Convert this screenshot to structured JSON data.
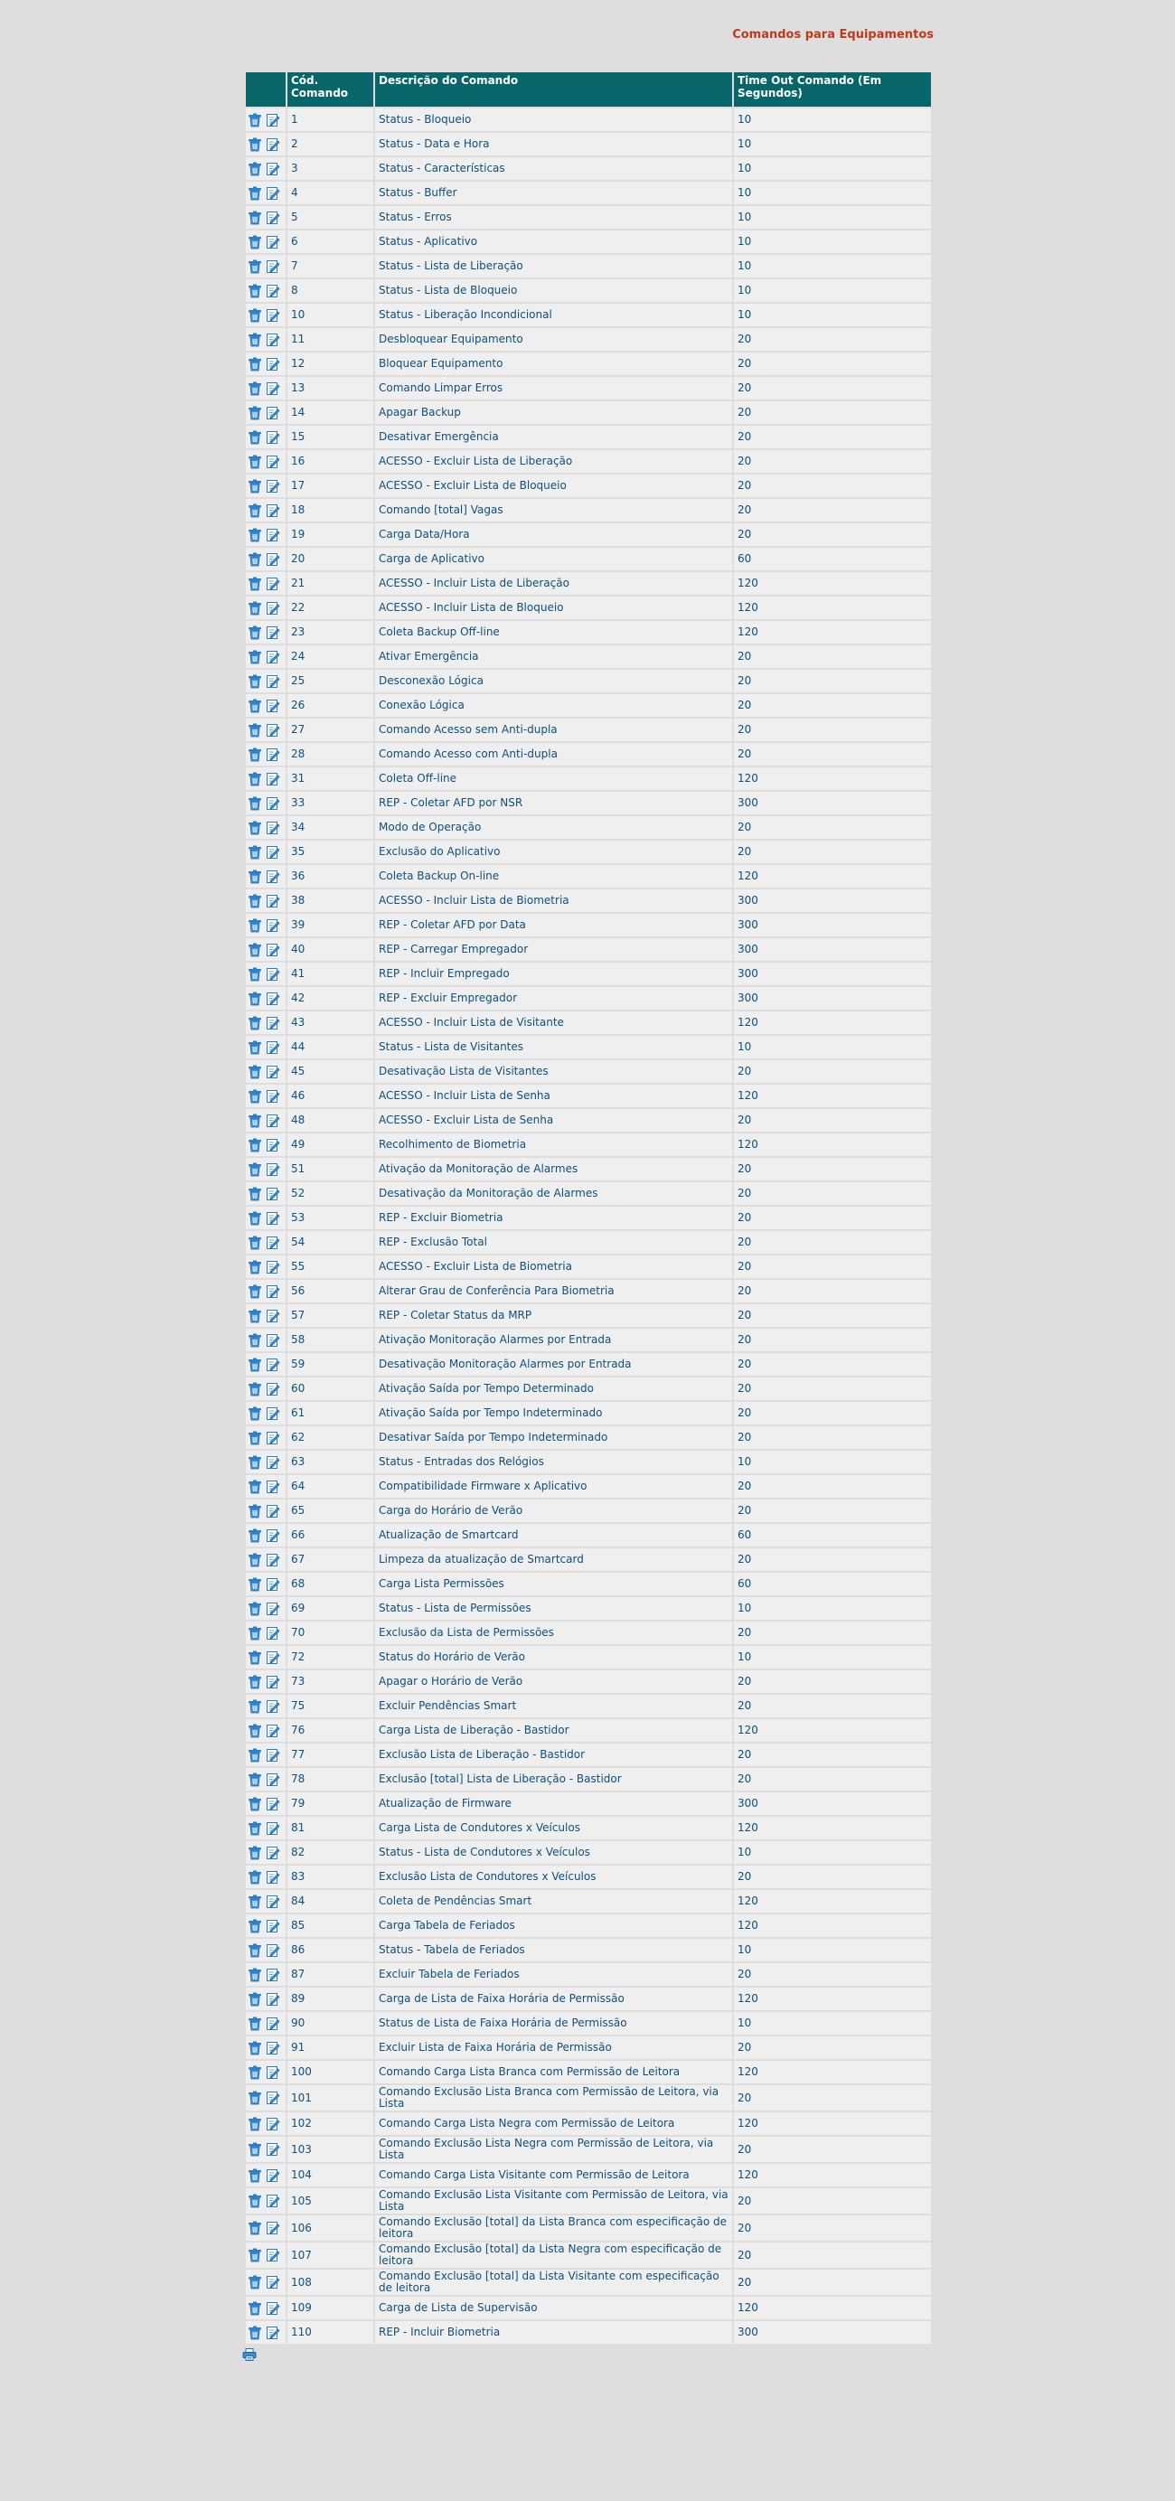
{
  "page": {
    "title": "Comandos para Equipamentos"
  },
  "table": {
    "headers": {
      "actions": "",
      "code": "Cód. Comando",
      "description": "Descrição do Comando",
      "timeout": "Time Out Comando (Em Segundos)"
    },
    "icons": {
      "delete": "trash-icon",
      "edit": "edit-icon",
      "print": "print-icon"
    },
    "rows": [
      {
        "code": "1",
        "description": "Status - Bloqueio",
        "timeout": "10"
      },
      {
        "code": "2",
        "description": "Status - Data e Hora",
        "timeout": "10"
      },
      {
        "code": "3",
        "description": "Status - Características",
        "timeout": "10"
      },
      {
        "code": "4",
        "description": "Status - Buffer",
        "timeout": "10"
      },
      {
        "code": "5",
        "description": "Status - Erros",
        "timeout": "10"
      },
      {
        "code": "6",
        "description": "Status - Aplicativo",
        "timeout": "10"
      },
      {
        "code": "7",
        "description": "Status - Lista de Liberação",
        "timeout": "10"
      },
      {
        "code": "8",
        "description": "Status - Lista de Bloqueio",
        "timeout": "10"
      },
      {
        "code": "10",
        "description": "Status - Liberação Incondicional",
        "timeout": "10"
      },
      {
        "code": "11",
        "description": "Desbloquear Equipamento",
        "timeout": "20"
      },
      {
        "code": "12",
        "description": "Bloquear Equipamento",
        "timeout": "20"
      },
      {
        "code": "13",
        "description": "Comando Limpar Erros",
        "timeout": "20"
      },
      {
        "code": "14",
        "description": "Apagar Backup",
        "timeout": "20"
      },
      {
        "code": "15",
        "description": "Desativar Emergência",
        "timeout": "20"
      },
      {
        "code": "16",
        "description": "ACESSO - Excluir Lista de Liberação",
        "timeout": "20"
      },
      {
        "code": "17",
        "description": "ACESSO - Excluir Lista de Bloqueio",
        "timeout": "20"
      },
      {
        "code": "18",
        "description": "Comando [total] Vagas",
        "timeout": "20"
      },
      {
        "code": "19",
        "description": "Carga Data/Hora",
        "timeout": "20"
      },
      {
        "code": "20",
        "description": "Carga de Aplicativo",
        "timeout": "60"
      },
      {
        "code": "21",
        "description": "ACESSO - Incluir Lista de Liberação",
        "timeout": "120"
      },
      {
        "code": "22",
        "description": "ACESSO - Incluir Lista de Bloqueio",
        "timeout": "120"
      },
      {
        "code": "23",
        "description": "Coleta Backup Off-line",
        "timeout": "120"
      },
      {
        "code": "24",
        "description": "Ativar Emergência",
        "timeout": "20"
      },
      {
        "code": "25",
        "description": "Desconexão Lógica",
        "timeout": "20"
      },
      {
        "code": "26",
        "description": "Conexão Lógica",
        "timeout": "20"
      },
      {
        "code": "27",
        "description": "Comando Acesso sem Anti-dupla",
        "timeout": "20"
      },
      {
        "code": "28",
        "description": "Comando Acesso com Anti-dupla",
        "timeout": "20"
      },
      {
        "code": "31",
        "description": "Coleta Off-line",
        "timeout": "120"
      },
      {
        "code": "33",
        "description": "REP - Coletar AFD por NSR",
        "timeout": "300"
      },
      {
        "code": "34",
        "description": "Modo de Operação",
        "timeout": "20"
      },
      {
        "code": "35",
        "description": "Exclusão do Aplicativo",
        "timeout": "20"
      },
      {
        "code": "36",
        "description": "Coleta Backup On-line",
        "timeout": "120"
      },
      {
        "code": "38",
        "description": "ACESSO - Incluir Lista de Biometria",
        "timeout": "300"
      },
      {
        "code": "39",
        "description": "REP - Coletar AFD por Data",
        "timeout": "300"
      },
      {
        "code": "40",
        "description": "REP - Carregar Empregador",
        "timeout": "300"
      },
      {
        "code": "41",
        "description": "REP - Incluir Empregado",
        "timeout": "300"
      },
      {
        "code": "42",
        "description": "REP - Excluir Empregador",
        "timeout": "300"
      },
      {
        "code": "43",
        "description": "ACESSO - Incluir Lista de Visitante",
        "timeout": "120"
      },
      {
        "code": "44",
        "description": "Status - Lista de Visitantes",
        "timeout": "10"
      },
      {
        "code": "45",
        "description": "Desativação Lista de Visitantes",
        "timeout": "20"
      },
      {
        "code": "46",
        "description": "ACESSO - Incluir Lista de Senha",
        "timeout": "120"
      },
      {
        "code": "48",
        "description": "ACESSO - Excluir Lista de Senha",
        "timeout": "20"
      },
      {
        "code": "49",
        "description": "Recolhimento de Biometria",
        "timeout": "120"
      },
      {
        "code": "51",
        "description": "Ativação da Monitoração de Alarmes",
        "timeout": "20"
      },
      {
        "code": "52",
        "description": "Desativação da Monitoração de Alarmes",
        "timeout": "20"
      },
      {
        "code": "53",
        "description": "REP - Excluir Biometria",
        "timeout": "20"
      },
      {
        "code": "54",
        "description": "REP - Exclusão Total",
        "timeout": "20"
      },
      {
        "code": "55",
        "description": "ACESSO - Excluir Lista de Biometria",
        "timeout": "20"
      },
      {
        "code": "56",
        "description": "Alterar Grau de Conferência Para Biometria",
        "timeout": "20"
      },
      {
        "code": "57",
        "description": "REP - Coletar Status da MRP",
        "timeout": "20"
      },
      {
        "code": "58",
        "description": "Ativação Monitoração Alarmes por Entrada",
        "timeout": "20"
      },
      {
        "code": "59",
        "description": "Desativação Monitoração Alarmes por Entrada",
        "timeout": "20"
      },
      {
        "code": "60",
        "description": "Ativação Saída por Tempo Determinado",
        "timeout": "20"
      },
      {
        "code": "61",
        "description": "Ativação Saída por Tempo Indeterminado",
        "timeout": "20"
      },
      {
        "code": "62",
        "description": "Desativar Saída por Tempo Indeterminado",
        "timeout": "20"
      },
      {
        "code": "63",
        "description": "Status - Entradas dos Relógios",
        "timeout": "10"
      },
      {
        "code": "64",
        "description": "Compatibilidade Firmware x Aplicativo",
        "timeout": "20"
      },
      {
        "code": "65",
        "description": "Carga do Horário de Verão",
        "timeout": "20"
      },
      {
        "code": "66",
        "description": "Atualização de Smartcard",
        "timeout": "60"
      },
      {
        "code": "67",
        "description": "Limpeza da atualização de Smartcard",
        "timeout": "20"
      },
      {
        "code": "68",
        "description": "Carga Lista Permissões",
        "timeout": "60"
      },
      {
        "code": "69",
        "description": "Status - Lista de Permissões",
        "timeout": "10"
      },
      {
        "code": "70",
        "description": "Exclusão da Lista de Permissões",
        "timeout": "20"
      },
      {
        "code": "72",
        "description": "Status do Horário de Verão",
        "timeout": "10"
      },
      {
        "code": "73",
        "description": "Apagar o Horário de Verão",
        "timeout": "20"
      },
      {
        "code": "75",
        "description": "Excluir Pendências Smart",
        "timeout": "20"
      },
      {
        "code": "76",
        "description": "Carga Lista de Liberação - Bastidor",
        "timeout": "120"
      },
      {
        "code": "77",
        "description": "Exclusão Lista de Liberação - Bastidor",
        "timeout": "20"
      },
      {
        "code": "78",
        "description": "Exclusão [total] Lista de Liberação - Bastidor",
        "timeout": "20"
      },
      {
        "code": "79",
        "description": "Atualização de Firmware",
        "timeout": "300"
      },
      {
        "code": "81",
        "description": "Carga Lista de Condutores x Veículos",
        "timeout": "120"
      },
      {
        "code": "82",
        "description": "Status - Lista de Condutores x Veículos",
        "timeout": "10"
      },
      {
        "code": "83",
        "description": "Exclusão Lista de Condutores x Veículos",
        "timeout": "20"
      },
      {
        "code": "84",
        "description": "Coleta de Pendências Smart",
        "timeout": "120"
      },
      {
        "code": "85",
        "description": "Carga Tabela de Feriados",
        "timeout": "120"
      },
      {
        "code": "86",
        "description": "Status - Tabela de Feriados",
        "timeout": "10"
      },
      {
        "code": "87",
        "description": "Excluir Tabela de Feriados",
        "timeout": "20"
      },
      {
        "code": "89",
        "description": "Carga de Lista de Faixa Horária de Permissão",
        "timeout": "120"
      },
      {
        "code": "90",
        "description": "Status de Lista de Faixa Horária de Permissão",
        "timeout": "10"
      },
      {
        "code": "91",
        "description": "Excluir Lista de Faixa Horária de Permissão",
        "timeout": "20"
      },
      {
        "code": "100",
        "description": "Comando Carga Lista Branca com Permissão de Leitora",
        "timeout": "120"
      },
      {
        "code": "101",
        "description": "Comando Exclusão Lista Branca com Permissão de Leitora, via Lista",
        "timeout": "20"
      },
      {
        "code": "102",
        "description": "Comando Carga Lista Negra com Permissão de Leitora",
        "timeout": "120"
      },
      {
        "code": "103",
        "description": "Comando Exclusão Lista Negra com Permissão de Leitora, via Lista",
        "timeout": "20"
      },
      {
        "code": "104",
        "description": "Comando Carga Lista Visitante com Permissão de Leitora",
        "timeout": "120"
      },
      {
        "code": "105",
        "description": "Comando Exclusão Lista Visitante com Permissão de Leitora, via Lista",
        "timeout": "20"
      },
      {
        "code": "106",
        "description": "Comando Exclusão [total] da Lista Branca com especificação de leitora",
        "timeout": "20"
      },
      {
        "code": "107",
        "description": "Comando Exclusão [total] da Lista Negra com especificação de leitora",
        "timeout": "20"
      },
      {
        "code": "108",
        "description": "Comando Exclusão [total] da Lista Visitante com especificação de leitora",
        "timeout": "20"
      },
      {
        "code": "109",
        "description": "Carga de Lista de Supervisão",
        "timeout": "120"
      },
      {
        "code": "110",
        "description": "REP - Incluir Biometria",
        "timeout": "300"
      }
    ]
  }
}
